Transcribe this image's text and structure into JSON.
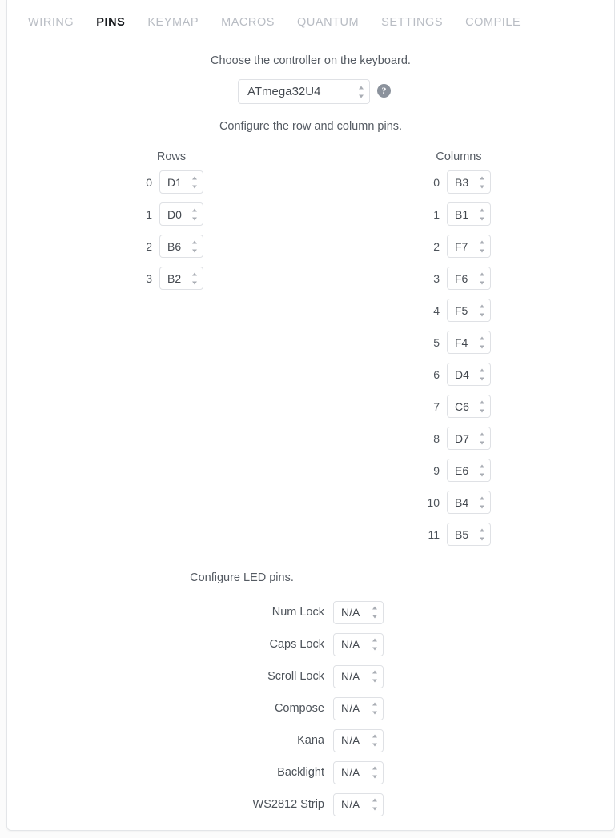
{
  "tabs": [
    {
      "label": "WIRING",
      "active": false
    },
    {
      "label": "PINS",
      "active": true
    },
    {
      "label": "KEYMAP",
      "active": false
    },
    {
      "label": "MACROS",
      "active": false
    },
    {
      "label": "QUANTUM",
      "active": false
    },
    {
      "label": "SETTINGS",
      "active": false
    },
    {
      "label": "COMPILE",
      "active": false
    }
  ],
  "controller": {
    "hint": "Choose the controller on the keyboard.",
    "value": "ATmega32U4",
    "help_icon": "question-mark-circle-icon",
    "help_glyph": "?"
  },
  "matrix": {
    "hint": "Configure the row and column pins.",
    "rows_header": "Rows",
    "columns_header": "Columns",
    "rows": [
      {
        "index": "0",
        "pin": "D1"
      },
      {
        "index": "1",
        "pin": "D0"
      },
      {
        "index": "2",
        "pin": "B6"
      },
      {
        "index": "3",
        "pin": "B2"
      }
    ],
    "columns": [
      {
        "index": "0",
        "pin": "B3"
      },
      {
        "index": "1",
        "pin": "B1"
      },
      {
        "index": "2",
        "pin": "F7"
      },
      {
        "index": "3",
        "pin": "F6"
      },
      {
        "index": "4",
        "pin": "F5"
      },
      {
        "index": "5",
        "pin": "F4"
      },
      {
        "index": "6",
        "pin": "D4"
      },
      {
        "index": "7",
        "pin": "C6"
      },
      {
        "index": "8",
        "pin": "D7"
      },
      {
        "index": "9",
        "pin": "E6"
      },
      {
        "index": "10",
        "pin": "B4"
      },
      {
        "index": "11",
        "pin": "B5"
      }
    ]
  },
  "led": {
    "hint": "Configure LED pins.",
    "items": [
      {
        "label": "Num Lock",
        "pin": "N/A"
      },
      {
        "label": "Caps Lock",
        "pin": "N/A"
      },
      {
        "label": "Scroll Lock",
        "pin": "N/A"
      },
      {
        "label": "Compose",
        "pin": "N/A"
      },
      {
        "label": "Kana",
        "pin": "N/A"
      },
      {
        "label": "Backlight",
        "pin": "N/A"
      },
      {
        "label": "WS2812 Strip",
        "pin": "N/A"
      }
    ]
  },
  "colors": {
    "card_bg": "#ffffff",
    "page_bg": "#fbfbfb",
    "tab_inactive": "#b9bdc4",
    "tab_active": "#16191d",
    "text": "#4d535a",
    "border": "#dfe1e5",
    "help_icon_bg": "#8b929c"
  }
}
